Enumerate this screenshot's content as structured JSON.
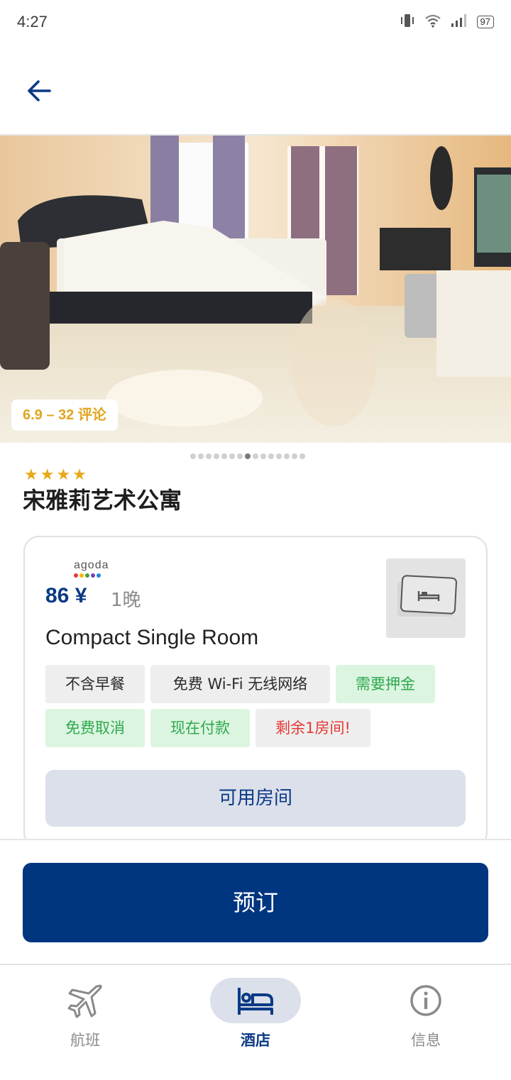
{
  "status_bar": {
    "time": "4:27",
    "battery": "97"
  },
  "hotel": {
    "rating_text": "6.9 – 32 评论",
    "stars": "★★★★",
    "name": "宋雅莉艺术公寓",
    "image_count": 15,
    "active_image": 7
  },
  "offer": {
    "provider": "agoda",
    "price": "86 ¥",
    "nights": "1晚",
    "room_name": "Compact Single Room",
    "tags": [
      {
        "label": "不含早餐",
        "style": "grey"
      },
      {
        "label": "免费 Wi-Fi 无线网络",
        "style": "grey"
      },
      {
        "label": "需要押金",
        "style": "green"
      },
      {
        "label": "免费取消",
        "style": "green"
      },
      {
        "label": "现在付款",
        "style": "green"
      },
      {
        "label": "剩余1房间!",
        "style": "red"
      }
    ],
    "available_rooms_button": "可用房间"
  },
  "book_button": "预订",
  "bottom_nav": [
    {
      "label": "航班",
      "icon": "plane-icon",
      "active": false
    },
    {
      "label": "酒店",
      "icon": "bed-icon",
      "active": true
    },
    {
      "label": "信息",
      "icon": "info-icon",
      "active": false
    }
  ],
  "colors": {
    "primary": "#003580",
    "accent_text": "#0b3a85",
    "rating": "#e0a51f",
    "green_tag_bg": "#dcf5e0",
    "green_tag_text": "#2fa84f",
    "red_text": "#e53935"
  }
}
